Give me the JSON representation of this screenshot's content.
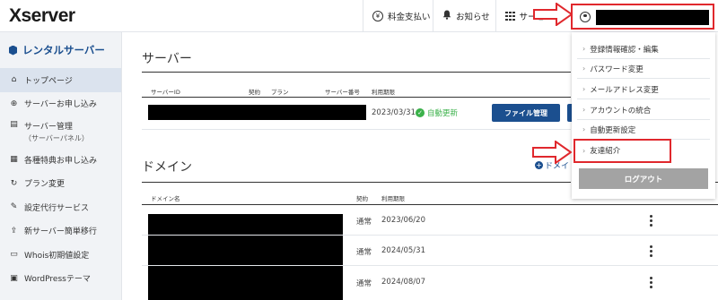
{
  "header": {
    "logo": "Xserver",
    "billing": "料金支払い",
    "notifications": "お知らせ",
    "services": "サービ"
  },
  "sidebar": {
    "title": "レンタルサーバー",
    "items": [
      {
        "label": "トップページ",
        "icon": "home-icon"
      },
      {
        "label": "サーバーお申し込み",
        "icon": "plus-circle-icon"
      },
      {
        "label": "サーバー管理",
        "sub": "（サーバーパネル）",
        "icon": "server-icon"
      },
      {
        "label": "各種特典お申し込み",
        "icon": "gift-icon"
      },
      {
        "label": "プラン変更",
        "icon": "refresh-icon"
      },
      {
        "label": "設定代行サービス",
        "icon": "wrench-icon"
      },
      {
        "label": "新サーバー簡単移行",
        "icon": "upload-icon"
      },
      {
        "label": "Whois初期値設定",
        "icon": "document-icon"
      },
      {
        "label": "WordPressテーマ",
        "icon": "wordpress-icon"
      }
    ]
  },
  "server_section": {
    "title": "サーバー",
    "columns": [
      "サーバーID",
      "契約",
      "プラン",
      "サーバー番号",
      "利用期限"
    ],
    "row": {
      "expiry": "2023/03/31",
      "auto_renew": "自動更新",
      "file_button": "ファイル管理"
    }
  },
  "domain_section": {
    "title": "ドメイン",
    "add_link": "ドメイ",
    "columns": [
      "ドメイン名",
      "契約",
      "利用期限"
    ],
    "rows": [
      {
        "contract": "通常",
        "expiry": "2023/06/20"
      },
      {
        "contract": "通常",
        "expiry": "2024/05/31"
      },
      {
        "contract": "通常",
        "expiry": "2024/08/07"
      }
    ]
  },
  "account_menu": {
    "items": [
      "登録情報確認・編集",
      "パスワード変更",
      "メールアドレス変更",
      "アカウントの統合",
      "自動更新設定",
      "友達紹介"
    ],
    "logout": "ログアウト"
  },
  "colors": {
    "brand": "#1b4f8f",
    "highlight": "#e0282d",
    "renew": "#3bb14a"
  }
}
